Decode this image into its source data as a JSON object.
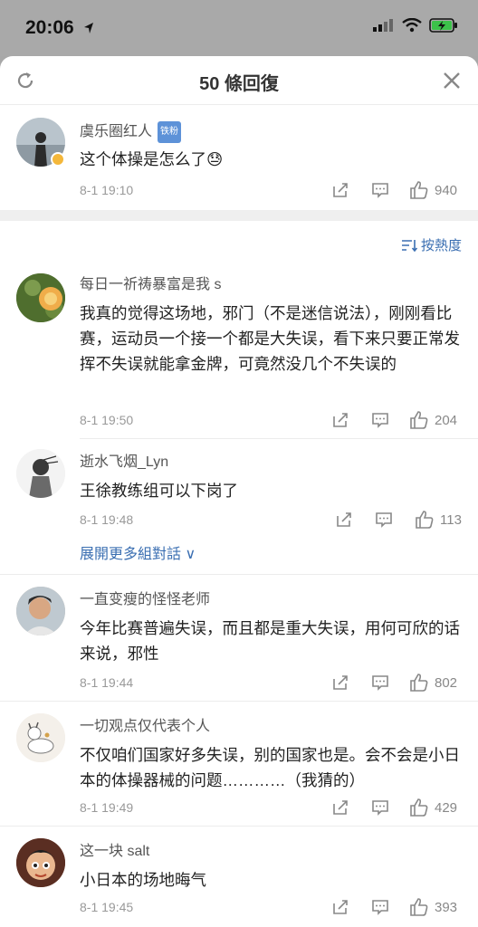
{
  "status": {
    "time": "20:06"
  },
  "header": {
    "title": "50 條回復"
  },
  "top_comment": {
    "username": "虞乐圈红人",
    "badge": "铁粉",
    "text": "这个体操是怎么了😓",
    "time": "8-1 19:10",
    "likes": "940"
  },
  "sort": {
    "label": "按熱度"
  },
  "expand": {
    "label": "展開更多組對話 ∨"
  },
  "comments": [
    {
      "username": "每日一祈祷暴富是我 s",
      "text": "我真的觉得这场地，邪门（不是迷信说法），刚刚看比赛，运动员一个接一个都是大失误，看下来只要正常发挥不失误就能拿金牌，可竟然没几个不失误的",
      "time": "8-1 19:50",
      "likes": "204"
    },
    {
      "username": "逝水飞烟_Lyn",
      "text": "王徐教练组可以下岗了",
      "time": "8-1 19:48",
      "likes": "113"
    },
    {
      "username": "一直变瘦的怪怪老师",
      "text": "今年比赛普遍失误，而且都是重大失误，用何可欣的话来说，邪性",
      "time": "8-1 19:44",
      "likes": "802"
    },
    {
      "username": "一切观点仅代表个人",
      "text": "不仅咱们国家好多失误，别的国家也是。会不会是小日本的体操器械的问题…………（我猜的）",
      "time": "8-1 19:49",
      "likes": "429"
    },
    {
      "username": "这一块 salt",
      "text": "小日本的场地晦气",
      "time": "8-1 19:45",
      "likes": "393"
    }
  ]
}
